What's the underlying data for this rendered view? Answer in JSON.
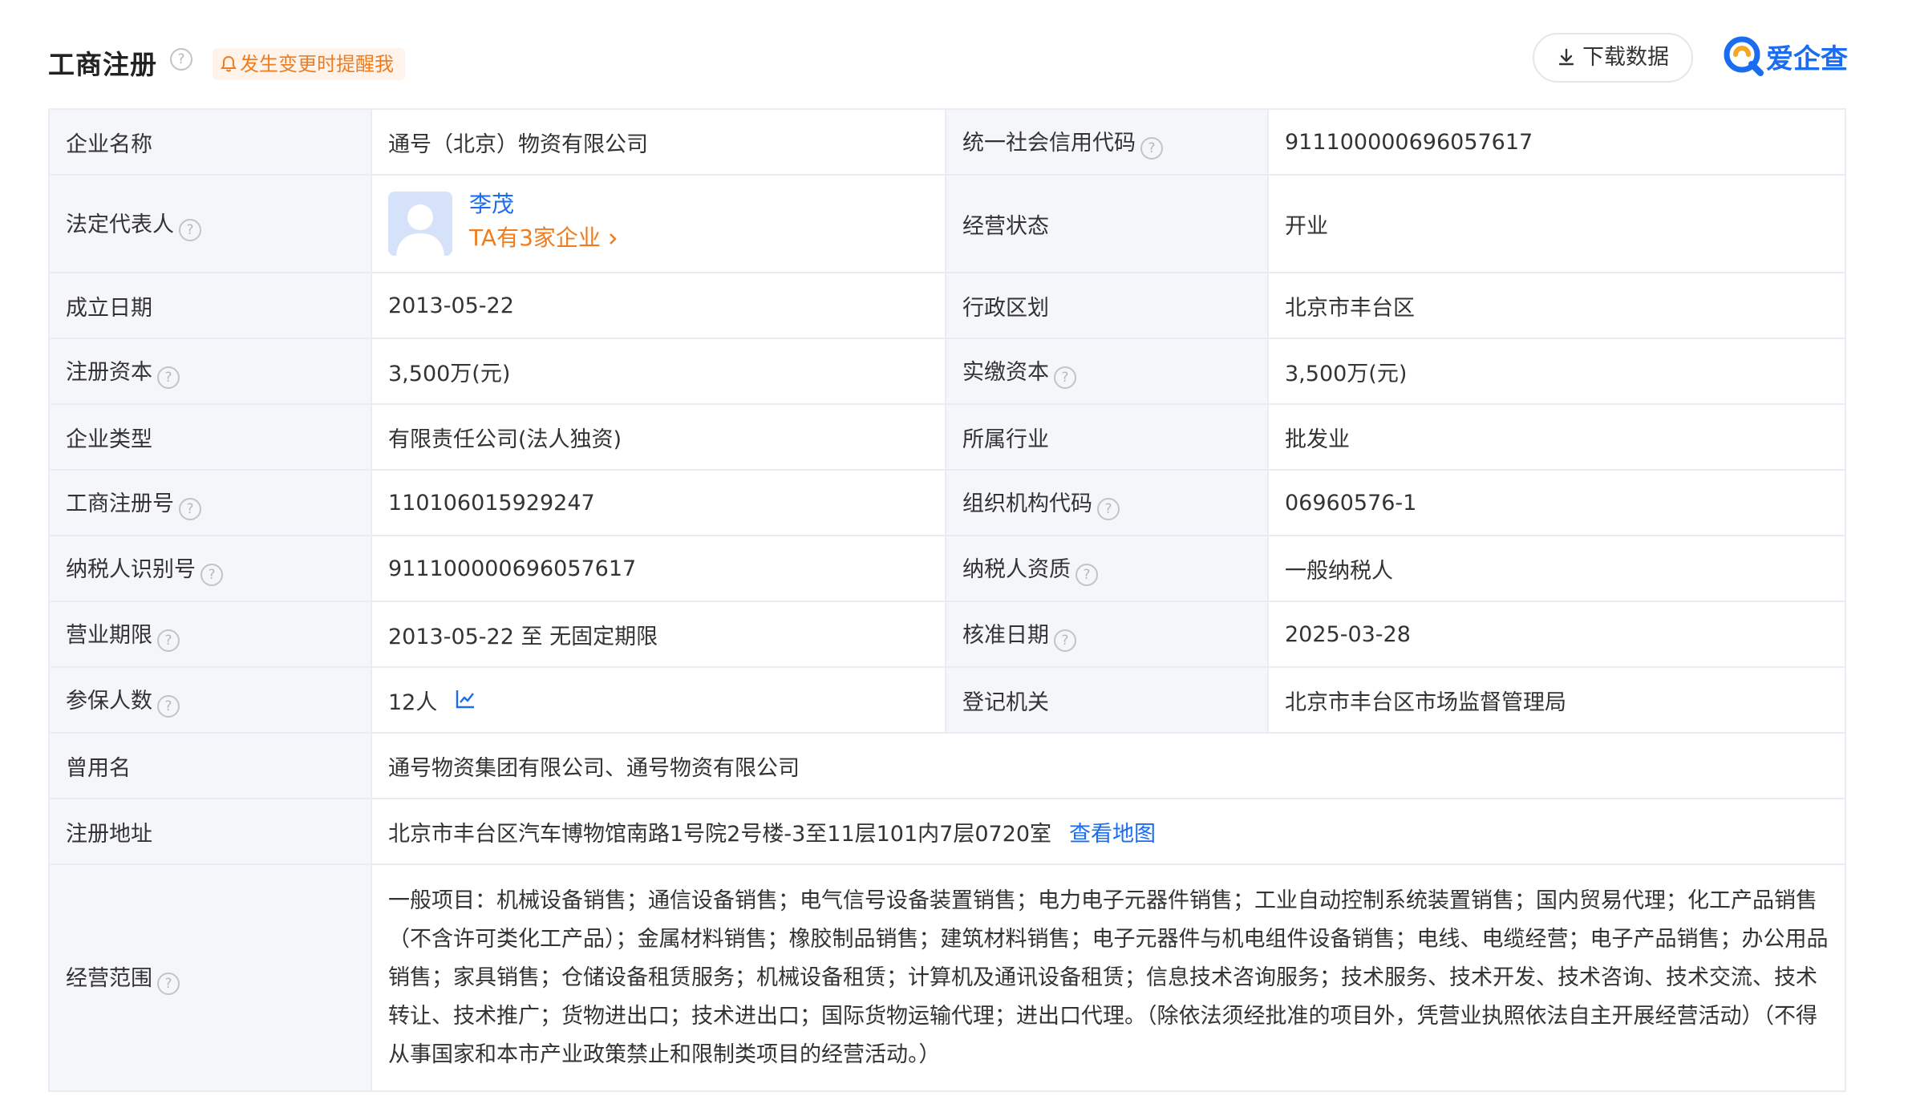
{
  "header": {
    "title": "工商注册",
    "remind_label": "发生变更时提醒我",
    "download_label": "下载数据",
    "logo_text": "爱企查"
  },
  "colors": {
    "accent_blue": "#1a6cf0",
    "accent_orange": "#f07c1e",
    "label_bg": "#f4f6fa",
    "border": "#e9ecf2"
  },
  "info": {
    "company_name_label": "企业名称",
    "company_name": "通号（北京）物资有限公司",
    "credit_code_label": "统一社会信用代码",
    "credit_code": "911100000696057617",
    "legal_rep_label": "法定代表人",
    "legal_rep_name": "李茂",
    "legal_rep_companies": "TA有3家企业",
    "status_label": "经营状态",
    "status": "开业",
    "founded_label": "成立日期",
    "founded": "2013-05-22",
    "region_label": "行政区划",
    "region": "北京市丰台区",
    "reg_capital_label": "注册资本",
    "reg_capital": "3,500万(元)",
    "paid_capital_label": "实缴资本",
    "paid_capital": "3,500万(元)",
    "company_type_label": "企业类型",
    "company_type": "有限责任公司(法人独资)",
    "industry_label": "所属行业",
    "industry": "批发业",
    "reg_no_label": "工商注册号",
    "reg_no": "110106015929247",
    "org_code_label": "组织机构代码",
    "org_code": "06960576-1",
    "taxpayer_id_label": "纳税人识别号",
    "taxpayer_id": "911100000696057617",
    "taxpayer_qual_label": "纳税人资质",
    "taxpayer_qual": "一般纳税人",
    "term_label": "营业期限",
    "term": "2013-05-22 至 无固定期限",
    "approval_date_label": "核准日期",
    "approval_date": "2025-03-28",
    "insured_label": "参保人数",
    "insured": "12人",
    "authority_label": "登记机关",
    "authority": "北京市丰台区市场监督管理局",
    "former_names_label": "曾用名",
    "former_names": "通号物资集团有限公司、通号物资有限公司",
    "address_label": "注册地址",
    "address": "北京市丰台区汽车博物馆南路1号院2号楼-3至11层101内7层0720室",
    "map_link": "查看地图",
    "scope_label": "经营范围",
    "scope": "一般项目：机械设备销售；通信设备销售；电气信号设备装置销售；电力电子元器件销售；工业自动控制系统装置销售；国内贸易代理；化工产品销售（不含许可类化工产品）；金属材料销售；橡胶制品销售；建筑材料销售；电子元器件与机电组件设备销售；电线、电缆经营；电子产品销售；办公用品销售；家具销售；仓储设备租赁服务；机械设备租赁；计算机及通讯设备租赁；信息技术咨询服务；技术服务、技术开发、技术咨询、技术交流、技术转让、技术推广；货物进出口；技术进出口；国际货物运输代理；进出口代理。（除依法须经批准的项目外，凭营业执照依法自主开展经营活动）（不得从事国家和本市产业政策禁止和限制类项目的经营活动。）"
  }
}
